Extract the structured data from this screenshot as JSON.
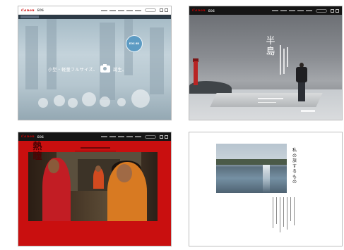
{
  "thumbnails": [
    {
      "brand": "Canon",
      "sub": "EOS",
      "tagline_left": "小型・軽量フルサイズ、",
      "tagline_right": "誕生。",
      "badge": "EOS 6D",
      "colors": {
        "bg": "#b5c6cf",
        "badge": "#5d9bc3"
      }
    },
    {
      "brand": "Canon",
      "sub": "EOS",
      "title": "半島",
      "colors": {
        "bg": "#8a8d92",
        "lighthouse": "#b82424"
      }
    },
    {
      "brand": "Canon",
      "sub": "EOS",
      "calligraphy": "熱瞳",
      "colors": {
        "bg": "#c90f0f"
      }
    },
    {
      "title": "私の旅するもの",
      "colors": {
        "bg": "#ffffff"
      }
    }
  ],
  "icons": [
    "camera-icon",
    "search-icon",
    "menu-icon"
  ]
}
